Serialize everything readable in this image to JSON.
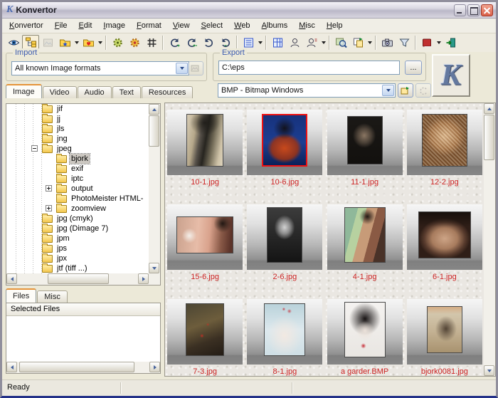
{
  "titlebar": {
    "icon_letter": "K",
    "title": "Konvertor"
  },
  "menubar": {
    "items": [
      "Konvertor",
      "File",
      "Edit",
      "Image",
      "Format",
      "View",
      "Select",
      "Web",
      "Albums",
      "Misc",
      "Help"
    ]
  },
  "toolbar": {
    "icons": [
      "preview-eye",
      "folder-tree",
      "image-pane",
      "favorites-folder-star",
      "favorites-folder-heart",
      "convert-gear",
      "convert-gear-color",
      "batch-grid",
      "rotate-right",
      "rotate-right-all",
      "rotate-left",
      "rotate-left-all",
      "list-view",
      "grid-view",
      "profile",
      "profile-alt",
      "browse-preview",
      "convert-files",
      "screen-capture",
      "filter-funnel",
      "help-book",
      "exit-door"
    ]
  },
  "import_panel": {
    "label": "Import",
    "format_value": "All known Image formats",
    "tabs": [
      "Image",
      "Video",
      "Audio",
      "Text",
      "Resources"
    ],
    "active_tab": "Image"
  },
  "export_panel": {
    "label": "Export",
    "path_value": "C:\\eps",
    "browse_label": "...",
    "format_value": "BMP - Bitmap Windows"
  },
  "logo": {
    "letter": "K"
  },
  "tree": {
    "items": [
      {
        "label": "jif",
        "level": 0
      },
      {
        "label": "jj",
        "level": 0
      },
      {
        "label": "jls",
        "level": 0
      },
      {
        "label": "jng",
        "level": 0
      },
      {
        "label": "jpeg",
        "level": 0,
        "expander": "minus",
        "state": "expanded"
      },
      {
        "label": "bjork",
        "level": 1,
        "selected": true
      },
      {
        "label": "exif",
        "level": 1
      },
      {
        "label": "iptc",
        "level": 1
      },
      {
        "label": "output",
        "level": 1,
        "expander": "plus"
      },
      {
        "label": "PhotoMeister HTML-",
        "level": 1
      },
      {
        "label": "zoomview",
        "level": 1,
        "expander": "plus"
      },
      {
        "label": "jpg (cmyk)",
        "level": 0
      },
      {
        "label": "jpg (Dimage 7)",
        "level": 0
      },
      {
        "label": "jpm",
        "level": 0
      },
      {
        "label": "jps",
        "level": 0
      },
      {
        "label": "jpx",
        "level": 0
      },
      {
        "label": "jtf (tiff ...)",
        "level": 0
      }
    ]
  },
  "files_panel": {
    "tabs": [
      "Files",
      "Misc"
    ],
    "active_tab": "Files",
    "header": "Selected Files"
  },
  "thumbnails": {
    "items": [
      {
        "label": "10-1.jpg",
        "selected": false
      },
      {
        "label": "10-6.jpg",
        "selected": true
      },
      {
        "label": "11-1.jpg",
        "selected": false
      },
      {
        "label": "12-2.jpg",
        "selected": false
      },
      {
        "label": "15-6.jpg",
        "selected": false
      },
      {
        "label": "2-6.jpg",
        "selected": false
      },
      {
        "label": "4-1.jpg",
        "selected": false
      },
      {
        "label": "6-1.jpg",
        "selected": false
      },
      {
        "label": "7-3.jpg",
        "selected": false
      },
      {
        "label": "8-1.jpg",
        "selected": false
      },
      {
        "label": "a garder.BMP",
        "selected": false
      },
      {
        "label": "bjork0081.jpg",
        "selected": false
      }
    ]
  },
  "statusbar": {
    "text": "Ready"
  },
  "colors": {
    "filename_red": "#cc2222",
    "group_label_blue": "#3c5bb0",
    "selection_border_red": "#ee1111",
    "active_tab_orange": "#e5943a"
  }
}
